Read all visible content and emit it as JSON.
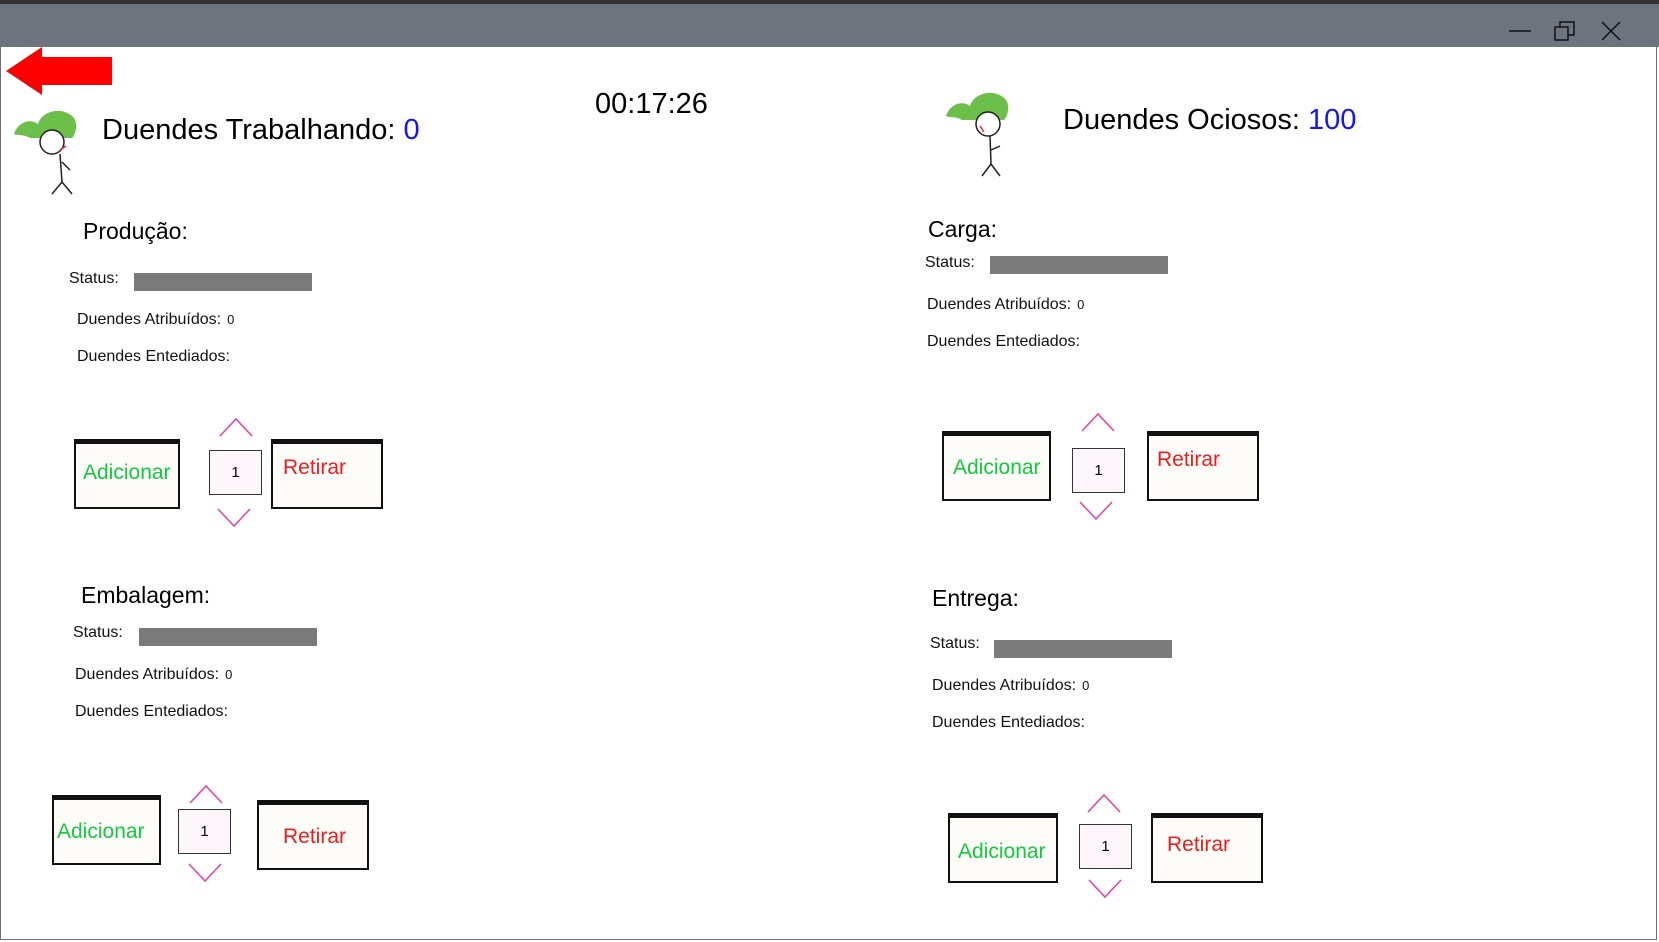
{
  "window": {
    "controls": [
      "minimize-icon",
      "restore-icon",
      "close-icon"
    ]
  },
  "header": {
    "working_label": "Duendes Trabalhando:",
    "working_count": "0",
    "timer": "00:17:26",
    "idle_label": "Duendes Ociosos:",
    "idle_count": "100"
  },
  "common": {
    "status_label": "Status:",
    "assigned_label": "Duendes Atribuídos:",
    "bored_label": "Duendes Entediados:",
    "add_label": "Adicionar",
    "remove_label": "Retirar"
  },
  "sections": {
    "producao": {
      "title": "Produção:",
      "assigned": "0",
      "quantity": "1"
    },
    "carga": {
      "title": "Carga:",
      "assigned": "0",
      "quantity": "1"
    },
    "embalagem": {
      "title": "Embalagem:",
      "assigned": "0",
      "quantity": "1"
    },
    "entrega": {
      "title": "Entrega:",
      "assigned": "0",
      "quantity": "1"
    }
  },
  "colors": {
    "titlebar": "#6d747d",
    "add_text": "#13c940",
    "remove_text": "#ee1c1c",
    "counter_value": "#1414ff",
    "chevron": "#e83ea3",
    "status_bar": "#7a7a7a",
    "elf_hat": "#6cc04a",
    "back_arrow": "#ff0000"
  }
}
